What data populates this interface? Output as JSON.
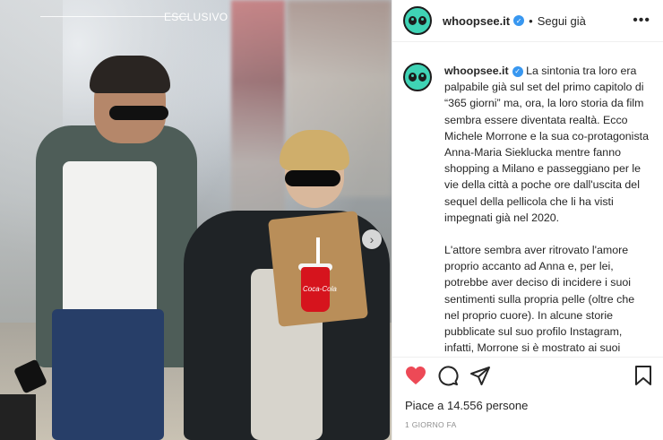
{
  "photo": {
    "overlay_label": "ESCLUSIVO",
    "cup_brand": "Coca-Cola"
  },
  "header": {
    "username": "whoopsee.it",
    "separator": "•",
    "follow_label": "Segui già",
    "more_icon": "more-icon"
  },
  "caption": {
    "username": "whoopsee.it",
    "paragraph1": "La sintonia tra loro era palpabile già sul set del primo capitolo di “365 giorni” ma, ora, la loro storia da film sembra essere diventata realtà. Ecco Michele Morrone e la sua co-protagonista Anna-Maria Sieklucka mentre fanno shopping a Milano e passeggiano per le vie della città a poche ore dall'uscita del sequel della pellicola che li ha visti impegnati già nel 2020.",
    "paragraph2": "L'attore sembra aver ritrovato l'amore proprio accanto ad Anna e, per lei, potrebbe aver deciso di incidere i suoi sentimenti sulla propria pelle (oltre che nel proprio cuore). In alcune storie pubblicate sul suo profilo Instagram, infatti, Morrone si è mostrato ai suoi follower con due nuovi tatuaggi..."
  },
  "likes": {
    "label": "Piace a 14.556 persone"
  },
  "timestamp": "1 GIORNO FA",
  "colors": {
    "like": "#ed4956",
    "verified": "#3897f0",
    "avatar_bg": "#3fd3b5"
  }
}
